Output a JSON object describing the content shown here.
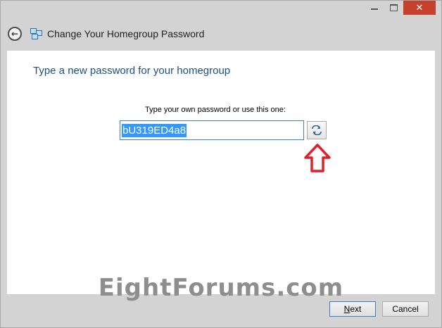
{
  "window": {
    "title": "Change Your Homegroup Password",
    "close_glyph": "✕"
  },
  "nav": {
    "back_glyph": "←"
  },
  "main": {
    "heading": "Type a new password for your homegroup",
    "password_label": "Type your own password or use this one:",
    "password_value": "bU319ED4a8"
  },
  "footer": {
    "next_label_first": "N",
    "next_label_rest": "ext",
    "cancel_label": "Cancel"
  },
  "watermark": "EightForums.com",
  "colors": {
    "heading": "#1d4f86",
    "selection": "#3399ff",
    "close_button": "#c7402b",
    "annotation_arrow": "#e0202a"
  }
}
